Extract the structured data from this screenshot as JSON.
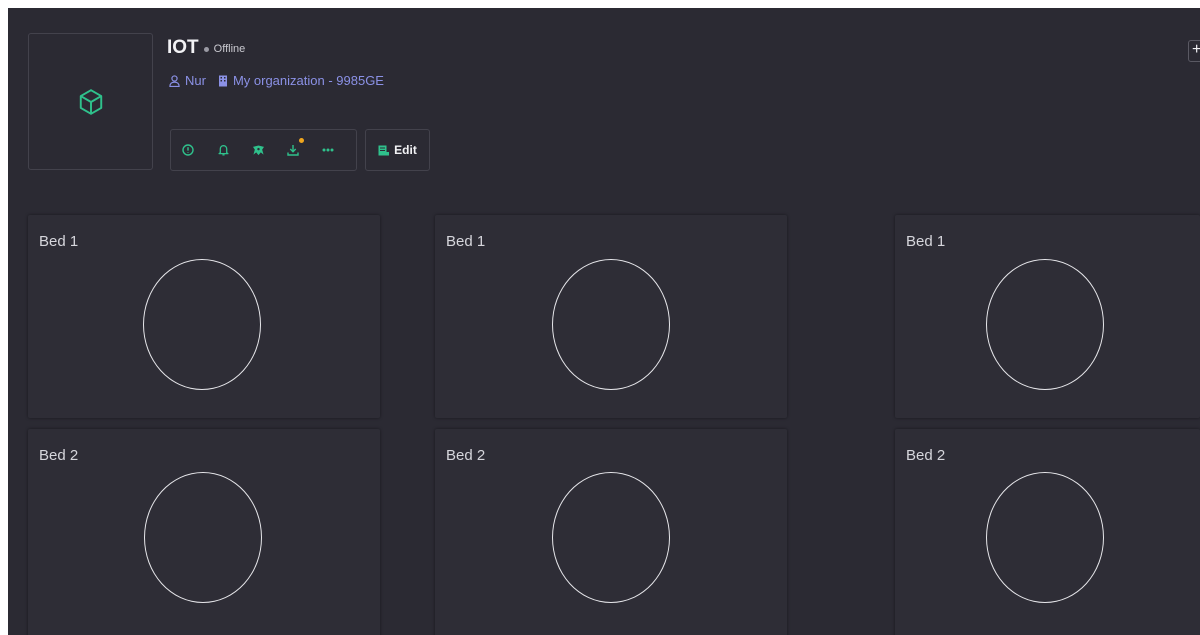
{
  "device": {
    "title": "IOT",
    "status": "Offline",
    "owner": "Nur",
    "organization": "My organization - 9985GE",
    "icon": "cube-icon"
  },
  "actions": [
    {
      "name": "info-button",
      "icon": "info-icon"
    },
    {
      "name": "alarm-button",
      "icon": "bell-icon"
    },
    {
      "name": "transform-button",
      "icon": "network-icon"
    },
    {
      "name": "download-button",
      "icon": "download-icon",
      "badge": true
    },
    {
      "name": "more-button",
      "icon": "more-icon"
    }
  ],
  "edit_label": "Edit",
  "corner_add_label": "+",
  "beds": [
    {
      "label": "Bed 1"
    },
    {
      "label": "Bed 1"
    },
    {
      "label": "Bed 1"
    },
    {
      "label": "Bed 2"
    },
    {
      "label": "Bed 2"
    },
    {
      "label": "Bed 2"
    }
  ],
  "colors": {
    "background": "#2b2a33",
    "accent_green": "#2fc18c",
    "link_blue": "#8b91e6",
    "badge_orange": "#f0a61e"
  }
}
